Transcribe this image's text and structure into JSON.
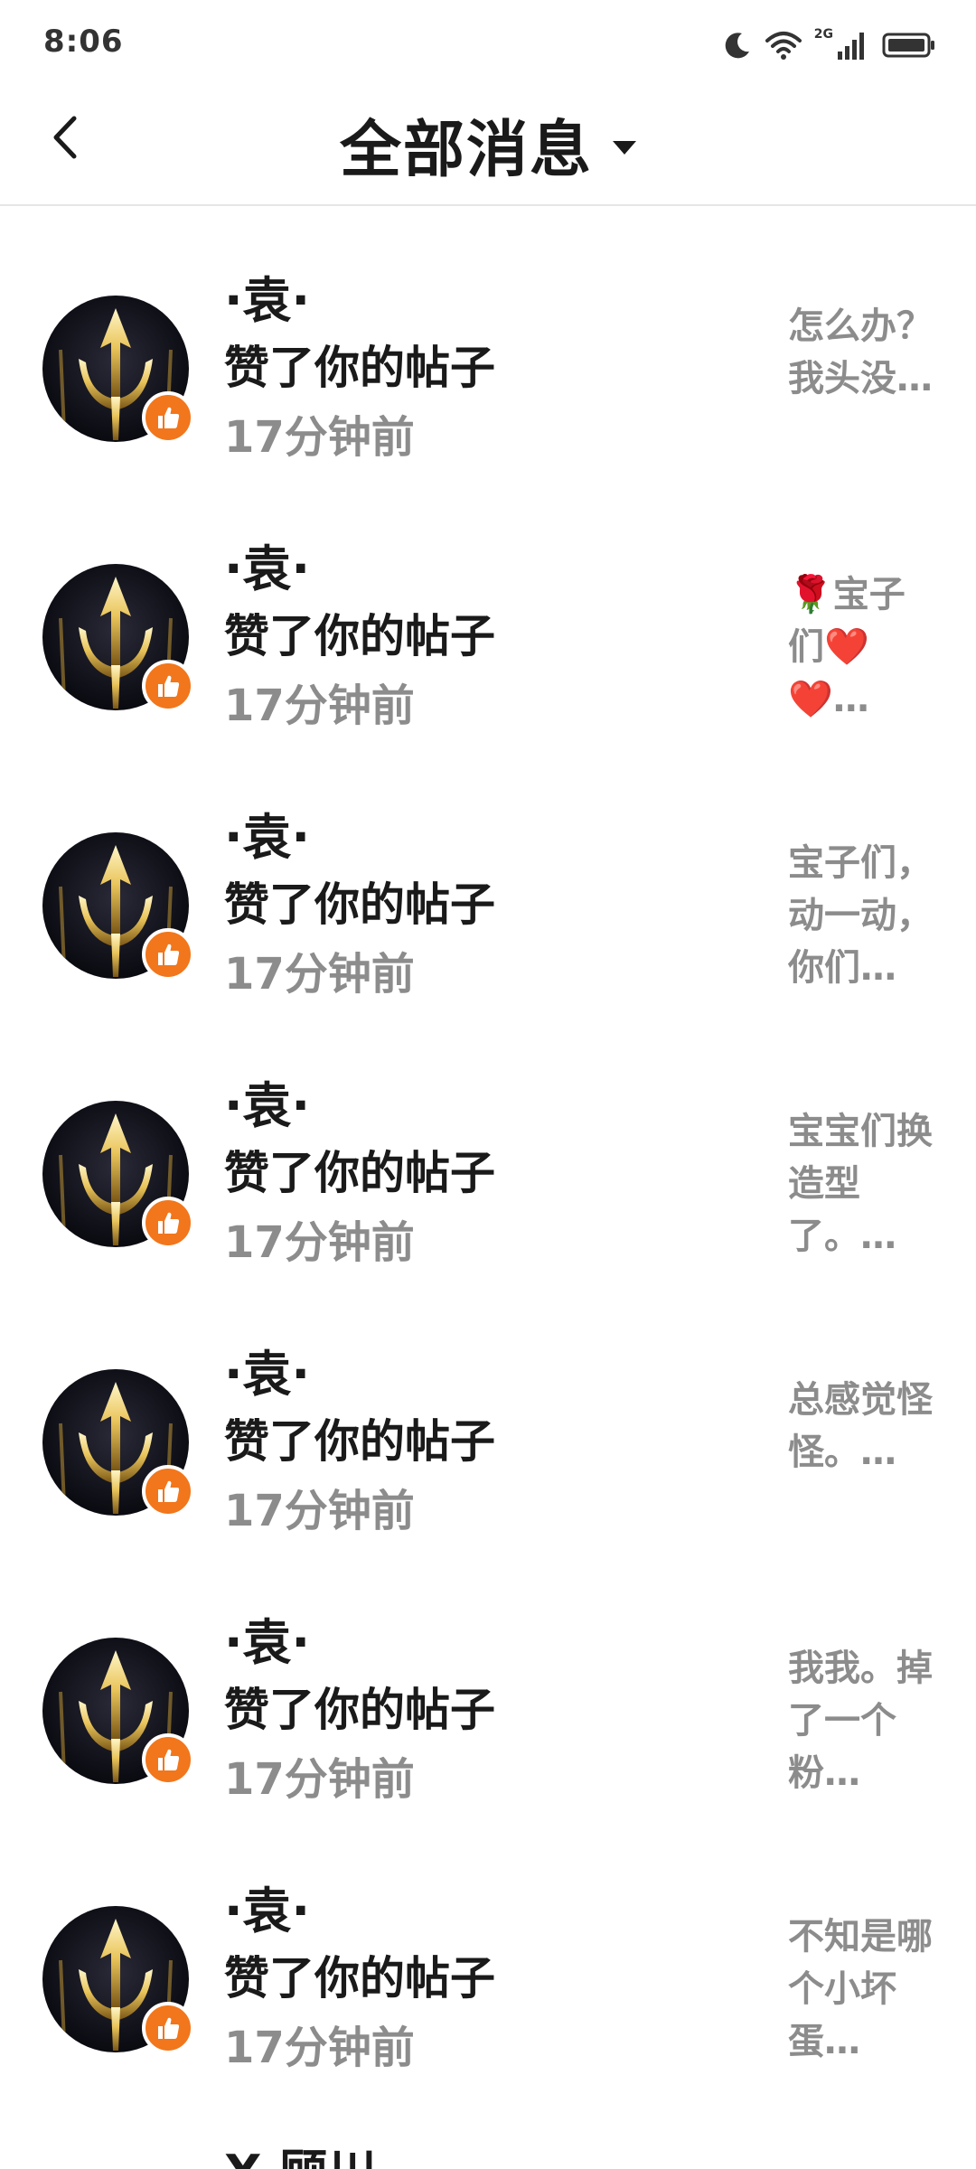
{
  "status_bar": {
    "time": "8:06",
    "network_label": "2G",
    "icons": [
      "moon-icon",
      "wifi-icon",
      "signal-icon",
      "battery-icon"
    ]
  },
  "header": {
    "title": "全部消息",
    "back_icon": "chevron-left-icon",
    "dropdown_icon": "caret-down-icon"
  },
  "colors": {
    "like_badge": "#f2761b",
    "secondary_text": "#8c8c8c",
    "primary_text": "#1a1a1a"
  },
  "items": [
    {
      "name": "·袁·",
      "action": "赞了你的帖子",
      "time": "17分钟前",
      "preview": "怎么办？我头没…"
    },
    {
      "name": "·袁·",
      "action": "赞了你的帖子",
      "time": "17分钟前",
      "preview": "🌹宝子们❤️❤️…"
    },
    {
      "name": "·袁·",
      "action": "赞了你的帖子",
      "time": "17分钟前",
      "preview": "宝子们，动一动，你们…"
    },
    {
      "name": "·袁·",
      "action": "赞了你的帖子",
      "time": "17分钟前",
      "preview": "宝宝们换造型了。…"
    },
    {
      "name": "·袁·",
      "action": "赞了你的帖子",
      "time": "17分钟前",
      "preview": "总感觉怪怪。…"
    },
    {
      "name": "·袁·",
      "action": "赞了你的帖子",
      "time": "17分钟前",
      "preview": "我我。掉了一个粉…"
    },
    {
      "name": "·袁·",
      "action": "赞了你的帖子",
      "time": "17分钟前",
      "preview": "不知是哪个小坏蛋…"
    }
  ],
  "partial_item": {
    "name": "X 顾川"
  }
}
